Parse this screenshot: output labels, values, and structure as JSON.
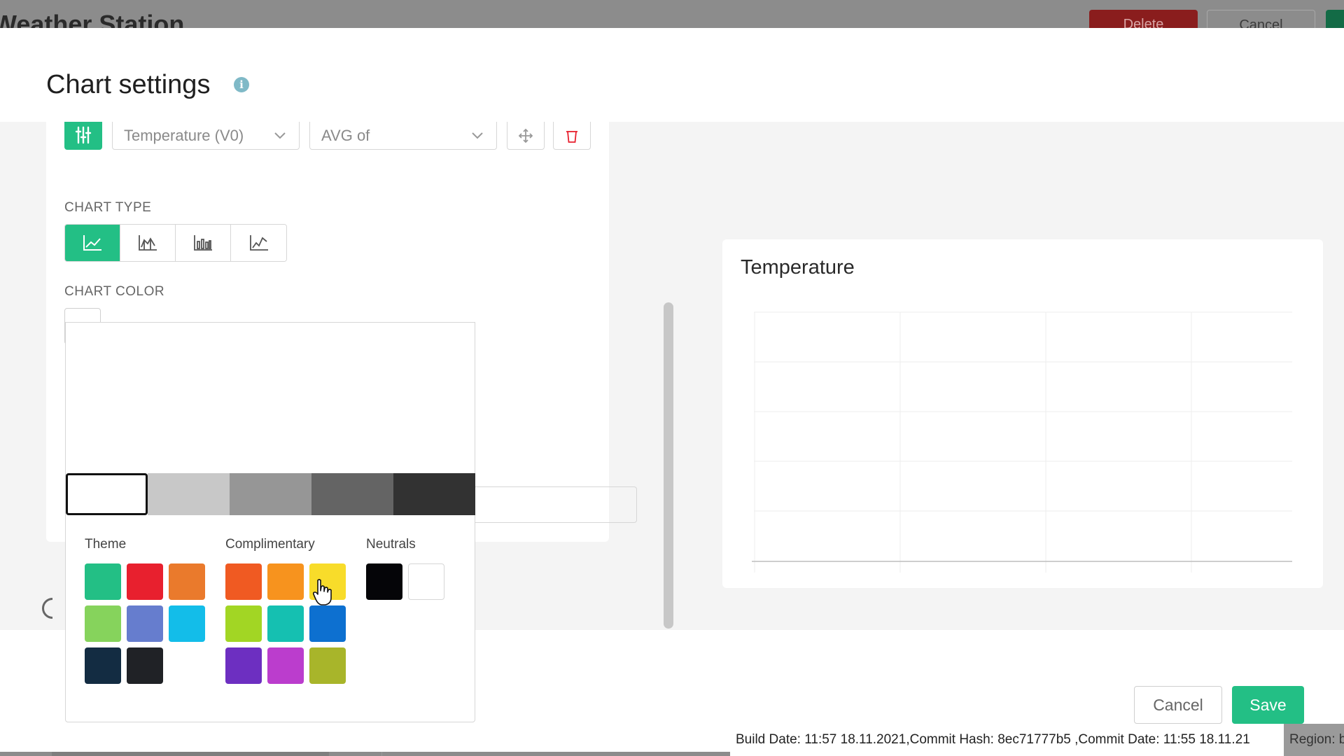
{
  "background": {
    "title": "Weather Station",
    "delete_label": "Delete",
    "cancel_label": "Cancel"
  },
  "modal": {
    "title": "Chart settings",
    "info_glyph": "i"
  },
  "datastream": {
    "stream_value": "Temperature (V0)",
    "aggregation_value": "AVG of"
  },
  "chart_type": {
    "label": "CHART TYPE",
    "options": [
      "line-chart-icon",
      "area-chart-icon",
      "bar-chart-icon",
      "line-chart-alt-icon"
    ],
    "selected_index": 0
  },
  "chart_color": {
    "label": "CHART COLOR",
    "selected": "#ffffff"
  },
  "picker": {
    "shades": [
      "#ffffff",
      "#c8c8c8",
      "#969696",
      "#646464",
      "#323232"
    ],
    "selected_shade_index": 0,
    "groups": [
      {
        "title": "Theme",
        "colors": [
          "#23bf85",
          "#e8202e",
          "#ea7a2c",
          "#86d35c",
          "#667dce",
          "#13bde9",
          "#132c42",
          "#202226"
        ]
      },
      {
        "title": "Complimentary",
        "colors": [
          "#f05a22",
          "#f7931e",
          "#f8dc2a",
          "#a2d624",
          "#15c0b1",
          "#0d70d0",
          "#6d2fc1",
          "#bb3dcd",
          "#a8b52a"
        ]
      },
      {
        "title": "Neutrals",
        "colors": [
          "#050508",
          "#ffffff"
        ]
      }
    ]
  },
  "preview": {
    "title": "Temperature"
  },
  "footer": {
    "cancel_label": "Cancel",
    "save_label": "Save"
  },
  "status": {
    "build_info": "Build Date: 11:57 18.11.2021,Commit Hash: 8ec71777b5 ,Commit Date: 11:55 18.11.21",
    "region": "Region: b"
  },
  "colors": {
    "accent": "#23bf85",
    "danger": "#e8202e"
  }
}
